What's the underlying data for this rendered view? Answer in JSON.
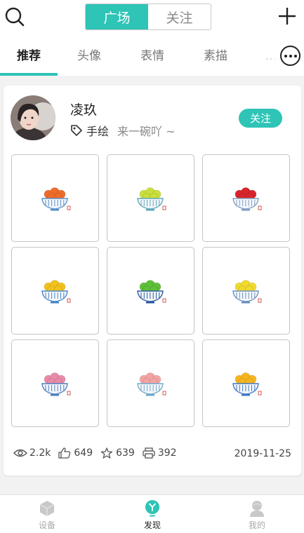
{
  "header": {
    "segments": [
      {
        "label": "广场",
        "active": true
      },
      {
        "label": "关注",
        "active": false
      }
    ]
  },
  "tabs": [
    {
      "label": "推荐",
      "active": true
    },
    {
      "label": "头像",
      "active": false
    },
    {
      "label": "表情",
      "active": false
    },
    {
      "label": "素描",
      "active": false
    }
  ],
  "post": {
    "username": "凌玖",
    "tag": "手绘",
    "subtitle": "来一碗吖 ~",
    "follow_label": "关注",
    "images": [
      {
        "fruit_color": "#ef6c2a",
        "bowl_color": "#5b8fc6"
      },
      {
        "fruit_color": "#c9df3c",
        "bowl_color": "#5fa8b8"
      },
      {
        "fruit_color": "#d8242c",
        "bowl_color": "#7fa0c2"
      },
      {
        "fruit_color": "#f2c21c",
        "bowl_color": "#4a86c5"
      },
      {
        "fruit_color": "#5fbf3a",
        "bowl_color": "#2a5a9e"
      },
      {
        "fruit_color": "#f1da2e",
        "bowl_color": "#6a8fc0"
      },
      {
        "fruit_color": "#e98aa8",
        "bowl_color": "#4e7fbf"
      },
      {
        "fruit_color": "#f3a3a3",
        "bowl_color": "#6fa8c8"
      },
      {
        "fruit_color": "#f6b51f",
        "bowl_color": "#3f79c0"
      }
    ],
    "stats": {
      "views": "2.2k",
      "likes": "649",
      "favorites": "639",
      "prints": "392"
    },
    "date": "2019-11-25"
  },
  "bottom_nav": [
    {
      "label": "设备",
      "icon": "device-icon",
      "active": false
    },
    {
      "label": "发现",
      "icon": "discover-icon",
      "active": true
    },
    {
      "label": "我的",
      "icon": "profile-icon",
      "active": false
    }
  ],
  "colors": {
    "accent": "#2ec4b6",
    "stamp": "#c9302c"
  }
}
